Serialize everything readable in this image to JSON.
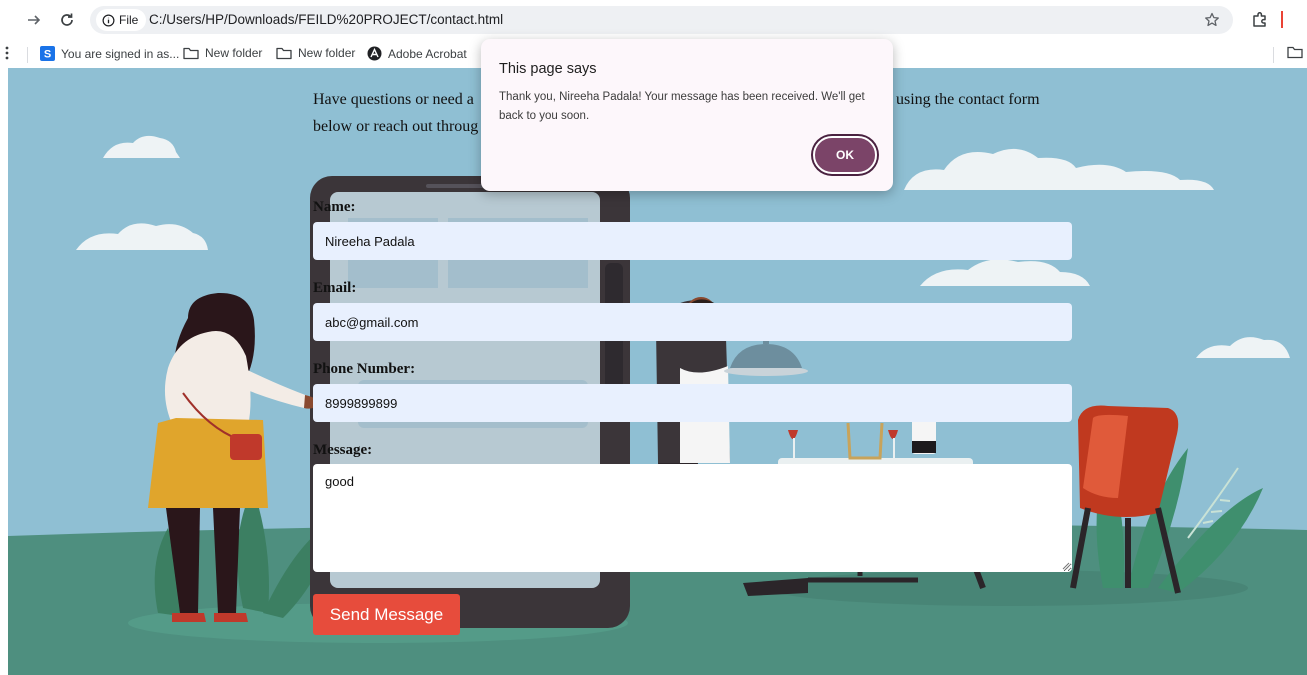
{
  "browser": {
    "site_chip_label": "File",
    "url": "C:/Users/HP/Downloads/FEILD%20PROJECT/contact.html",
    "bookmarks": [
      {
        "label": "You are signed in as...",
        "icon": "s-badge-icon"
      },
      {
        "label": "New folder",
        "icon": "folder-icon"
      },
      {
        "label": "New folder",
        "icon": "folder-icon"
      },
      {
        "label": "Adobe Acrobat",
        "icon": "acrobat-icon"
      }
    ]
  },
  "page": {
    "intro_start": "Have questions or need a",
    "intro_end": "using the contact form",
    "intro_line2": "below or reach out throug",
    "form": {
      "name_label": "Name:",
      "name_value": "Nireeha Padala",
      "email_label": "Email:",
      "email_value": "abc@gmail.com",
      "phone_label": "Phone Number:",
      "phone_value": "8999899899",
      "message_label": "Message:",
      "message_value": "good",
      "submit_label": "Send Message"
    }
  },
  "dialog": {
    "title": "This page says",
    "message": "Thank you, Nireeha Padala! Your message has been received. We'll get back to you soon.",
    "ok_label": "OK"
  },
  "colors": {
    "sky": "#8fbfd3",
    "ground": "#4e8f7f",
    "submit_button": "#e74c3c",
    "ok_button": "#7b4468",
    "input_fill": "#e8f0fe"
  }
}
